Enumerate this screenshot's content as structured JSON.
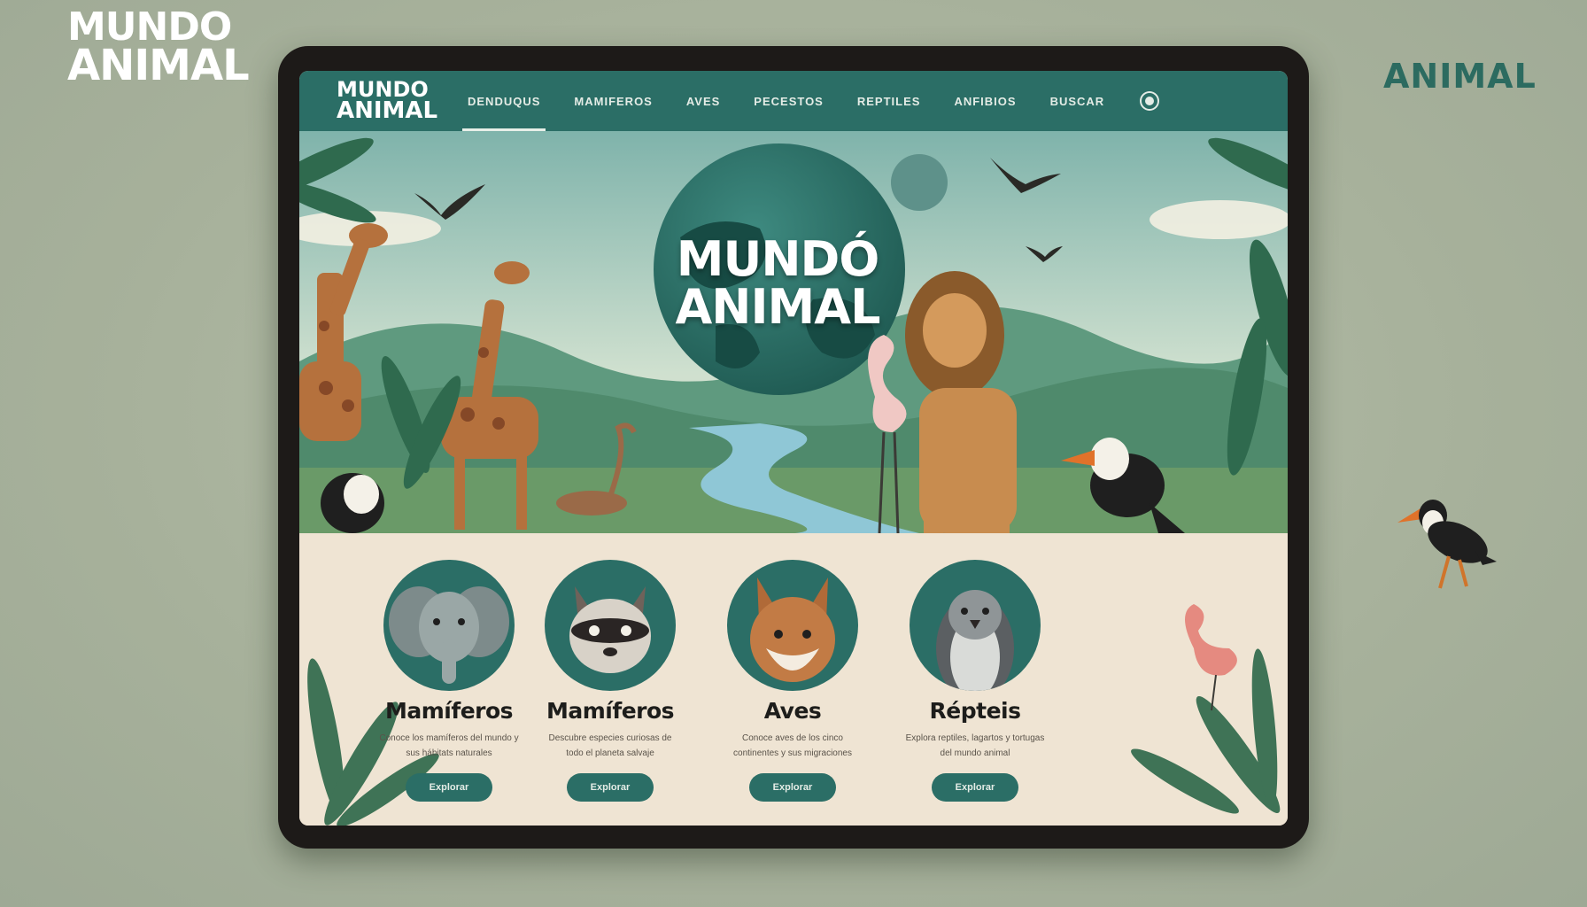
{
  "corner_logo": {
    "line1": "MUNDO",
    "line2": "ANIMAL"
  },
  "corner_right_text": "ANIMAL",
  "nav": {
    "logo_line1": "MUNDO",
    "logo_line2": "ANIMAL",
    "items": [
      "DENDUQUS",
      "MAMIFEROS",
      "AVES",
      "PECESTOS",
      "REPTILES",
      "ANFIBIOS",
      "BUSCAR"
    ],
    "active_index": 0
  },
  "hero": {
    "title_line1": "MUNDÓ",
    "title_line2": "ANIMAL"
  },
  "categories": [
    {
      "title": "Mamíferos",
      "desc": "Conoce los mamíferos del mundo y sus hábitats naturales",
      "button": "Explorar",
      "icon": "elephant-icon"
    },
    {
      "title": "Mamíferos",
      "desc": "Descubre especies curiosas de todo el planeta salvaje",
      "button": "Explorar",
      "icon": "raccoon-icon"
    },
    {
      "title": "Aves",
      "desc": "Conoce aves de los cinco continentes y sus migraciones",
      "button": "Explorar",
      "icon": "fox-icon"
    },
    {
      "title": "Répteis",
      "desc": "Explora reptiles, lagartos y tortugas del mundo animal",
      "button": "Explorar",
      "icon": "penguin-icon"
    }
  ],
  "colors": {
    "brand": "#2b6e66",
    "background": "#a9b39c",
    "panel": "#efe4d3"
  }
}
